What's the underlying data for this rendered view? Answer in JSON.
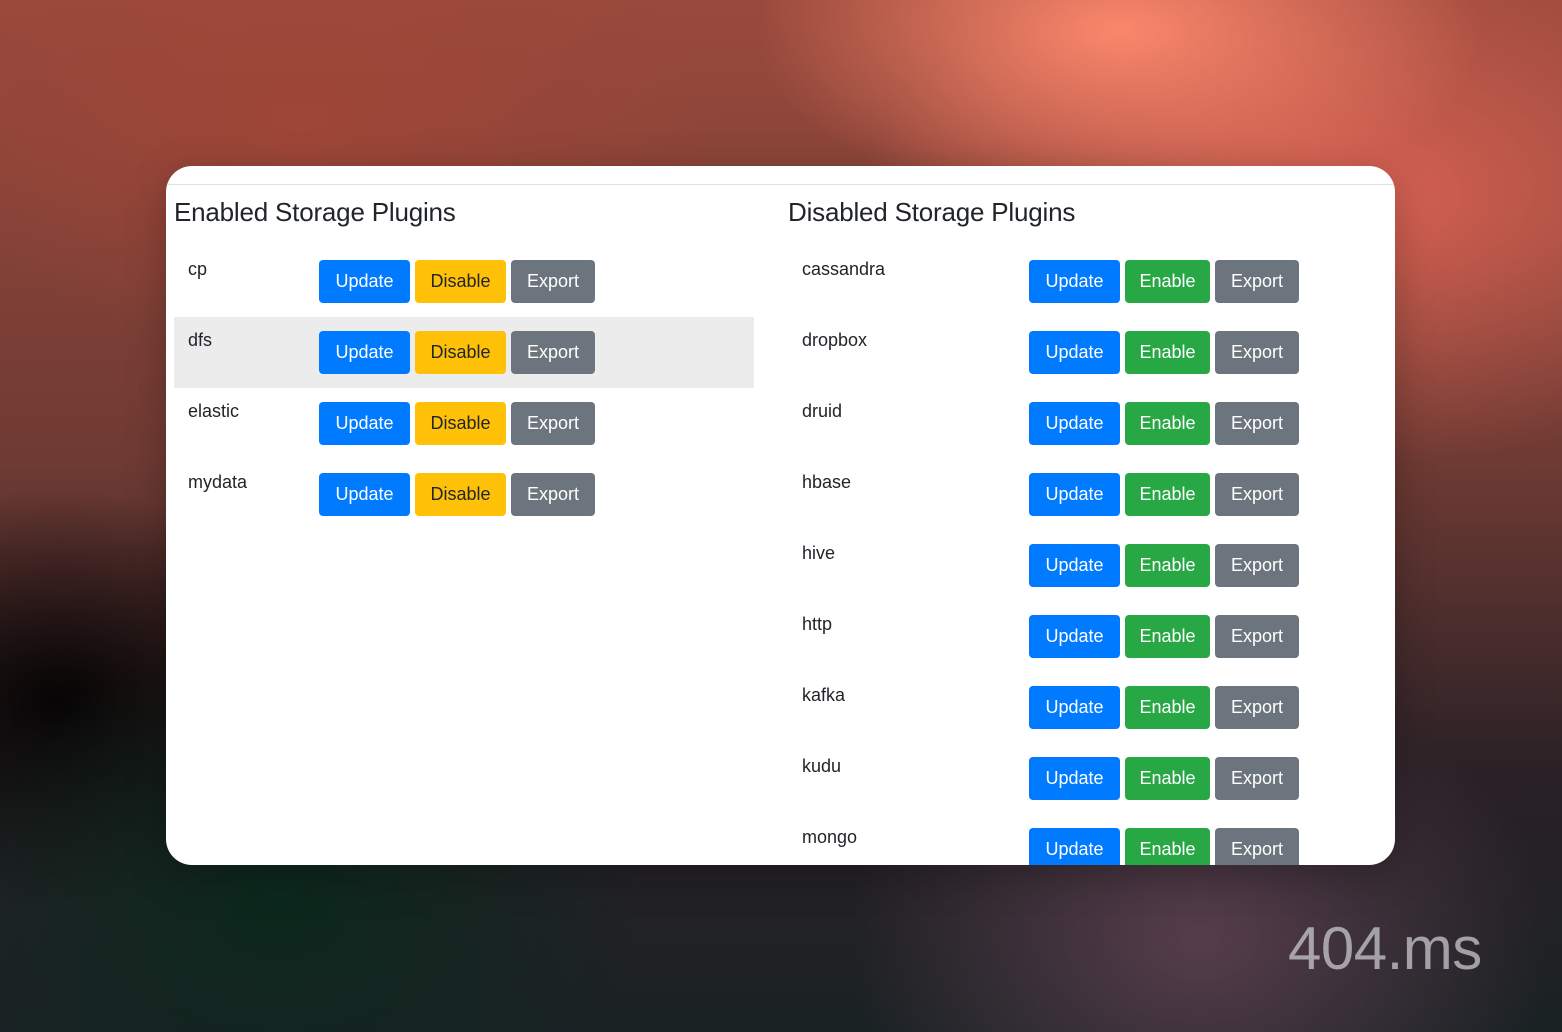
{
  "enabled": {
    "title": "Enabled Storage Plugins",
    "plugins": [
      {
        "name": "cp",
        "update": "Update",
        "toggle": "Disable",
        "export": "Export"
      },
      {
        "name": "dfs",
        "update": "Update",
        "toggle": "Disable",
        "export": "Export"
      },
      {
        "name": "elastic",
        "update": "Update",
        "toggle": "Disable",
        "export": "Export"
      },
      {
        "name": "mydata",
        "update": "Update",
        "toggle": "Disable",
        "export": "Export"
      }
    ]
  },
  "disabled": {
    "title": "Disabled Storage Plugins",
    "plugins": [
      {
        "name": "cassandra",
        "update": "Update",
        "toggle": "Enable",
        "export": "Export"
      },
      {
        "name": "dropbox",
        "update": "Update",
        "toggle": "Enable",
        "export": "Export"
      },
      {
        "name": "druid",
        "update": "Update",
        "toggle": "Enable",
        "export": "Export"
      },
      {
        "name": "hbase",
        "update": "Update",
        "toggle": "Enable",
        "export": "Export"
      },
      {
        "name": "hive",
        "update": "Update",
        "toggle": "Enable",
        "export": "Export"
      },
      {
        "name": "http",
        "update": "Update",
        "toggle": "Enable",
        "export": "Export"
      },
      {
        "name": "kafka",
        "update": "Update",
        "toggle": "Enable",
        "export": "Export"
      },
      {
        "name": "kudu",
        "update": "Update",
        "toggle": "Enable",
        "export": "Export"
      },
      {
        "name": "mongo",
        "update": "Update",
        "toggle": "Enable",
        "export": "Export"
      }
    ]
  },
  "watermark": "404.ms",
  "colors": {
    "update": "#007bff",
    "disable": "#ffc107",
    "enable": "#28a745",
    "export": "#6c757d",
    "hover_row": "#ececec"
  }
}
